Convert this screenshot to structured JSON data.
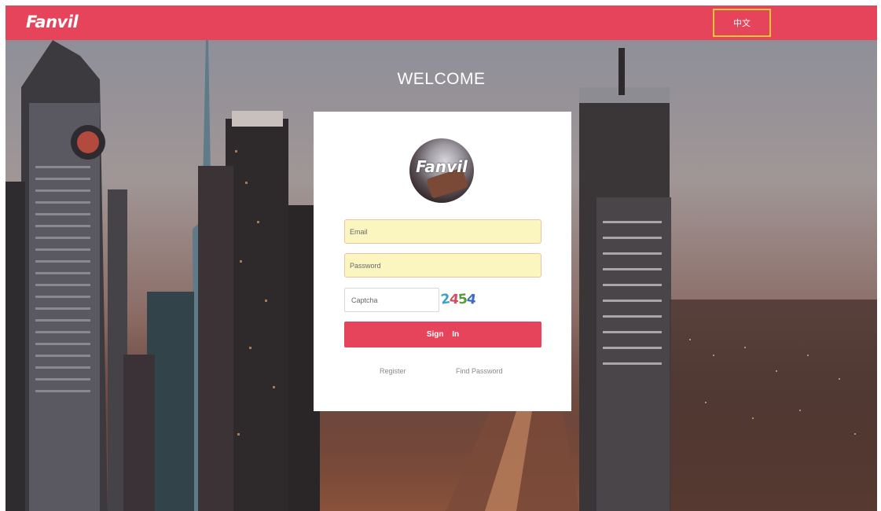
{
  "header": {
    "logo": "Fanvil",
    "language_button": "中文"
  },
  "main": {
    "welcome": "WELCOME",
    "avatar_brand": "Fanvil"
  },
  "form": {
    "email_placeholder": "Email",
    "password_placeholder": "Password",
    "captcha_placeholder": "Captcha",
    "captcha_code": [
      "2",
      "4",
      "5",
      "4"
    ],
    "signin_label": "Sign  In",
    "register_link": "Register",
    "find_password_link": "Find Password"
  },
  "colors": {
    "accent": "#e5445a",
    "input_fill": "#fbf5bf",
    "language_highlight": "#f7c934"
  }
}
